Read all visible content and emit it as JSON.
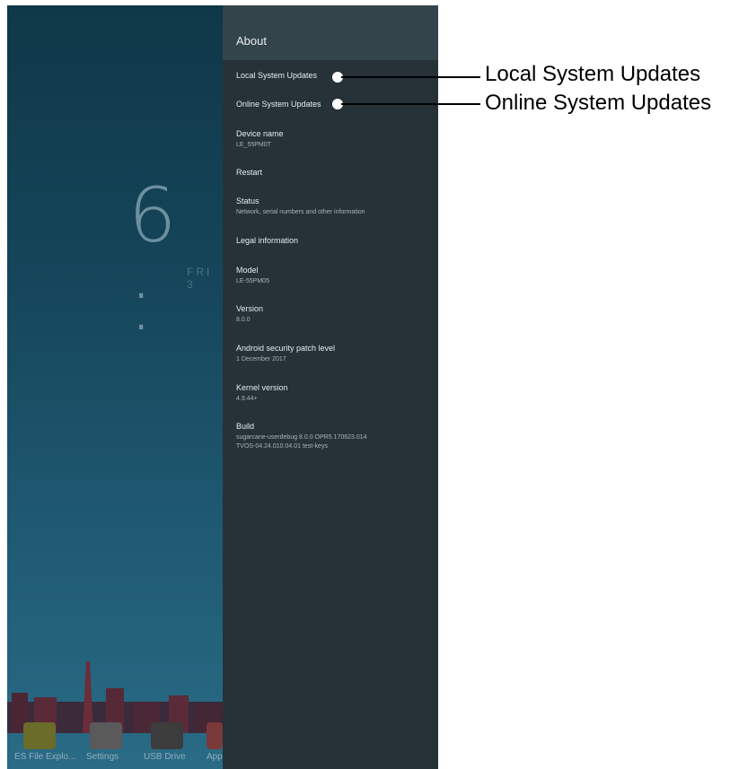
{
  "launcher": {
    "clock": "6 :",
    "date": "FRI 3",
    "apps": [
      {
        "label": "ES File Explo..."
      },
      {
        "label": "Settings"
      },
      {
        "label": "USB Drive"
      },
      {
        "label": "App"
      }
    ]
  },
  "about": {
    "title": "About",
    "items": [
      {
        "title": "Local System Updates",
        "sub": ""
      },
      {
        "title": "Online System Updates",
        "sub": ""
      },
      {
        "title": "Device name",
        "sub": "LE_55PM0T"
      },
      {
        "title": "Restart",
        "sub": ""
      },
      {
        "title": "Status",
        "sub": "Network, serial numbers and other information"
      },
      {
        "title": "Legal information",
        "sub": ""
      },
      {
        "title": "Model",
        "sub": "LE-55PM05"
      },
      {
        "title": "Version",
        "sub": "8.0.0"
      },
      {
        "title": "Android security patch level",
        "sub": "1 December 2017"
      },
      {
        "title": "Kernel version",
        "sub": "4.9.44+"
      },
      {
        "title": "Build",
        "sub": "sugarcane-userdebug 8.0.0 OPR5.170623.014",
        "sub2": "TVOS-04.24.010.04.01 test-keys"
      }
    ]
  },
  "callouts": [
    {
      "label": "Local System Updates"
    },
    {
      "label": "Online System Updates"
    }
  ],
  "colors": {
    "panel_bg": "#263238",
    "panel_header": "#34444b",
    "callout_line": "#000000"
  }
}
